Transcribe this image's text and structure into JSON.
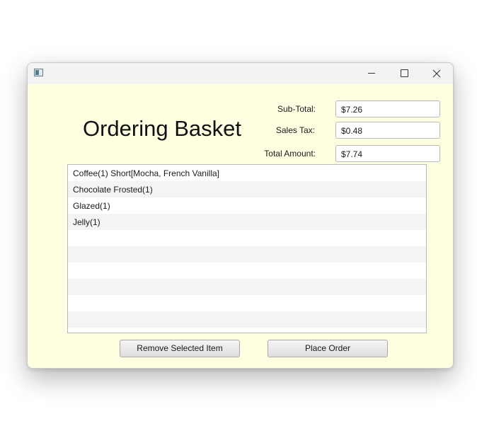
{
  "window": {
    "title": "",
    "icon": "java-app-icon"
  },
  "titlebar_buttons": {
    "minimize": "minimize-icon",
    "maximize": "maximize-icon",
    "close": "close-icon"
  },
  "heading": "Ordering Basket",
  "totals": {
    "subtotal_label": "Sub-Total:",
    "subtotal_value": "$7.26",
    "tax_label": "Sales Tax:",
    "tax_value": "$0.48",
    "total_label": "Total Amount:",
    "total_value": "$7.74"
  },
  "basket_items": [
    "Coffee(1) Short[Mocha, French Vanilla]",
    "Chocolate Frosted(1)",
    "Glazed(1)",
    "Jelly(1)"
  ],
  "buttons": {
    "remove": "Remove Selected Item",
    "place": "Place Order"
  },
  "colors": {
    "window_background": "#fefee0",
    "titlebar": "#f3f3f3"
  }
}
